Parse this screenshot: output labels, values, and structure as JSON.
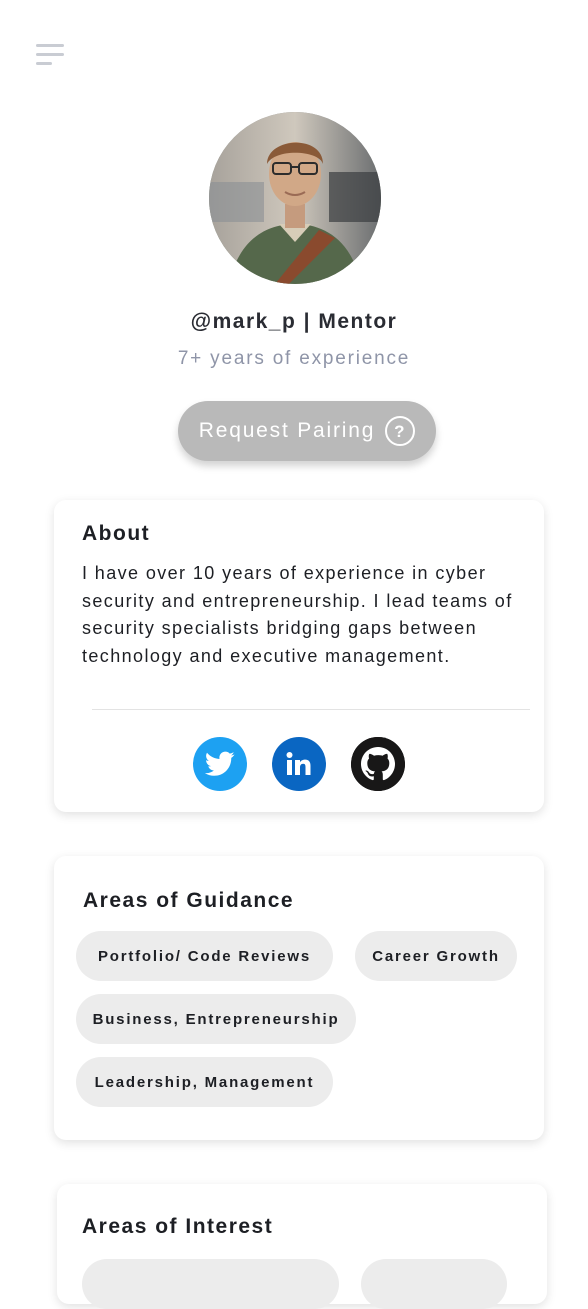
{
  "header": {
    "menu_icon": "hamburger-menu-icon"
  },
  "profile": {
    "avatar_alt": "profile photo",
    "handle": "@mark_p | Mentor",
    "experience": "7+ years of experience",
    "request_button": "Request Pairing",
    "help_glyph": "?"
  },
  "about": {
    "title": "About",
    "text": "I have over 10 years of experience in cyber security and entrepreneurship. I lead teams of security specialists bridging gaps between technology and executive management.",
    "socials": [
      {
        "name": "twitter",
        "icon": "twitter-icon",
        "color": "#1da1f2"
      },
      {
        "name": "linkedin",
        "icon": "linkedin-icon",
        "color": "#0a66c2"
      },
      {
        "name": "github",
        "icon": "github-icon",
        "color": "#181717"
      }
    ]
  },
  "guidance": {
    "title": "Areas of Guidance",
    "tags": [
      "Portfolio/ Code Reviews",
      "Career Growth",
      "Business, Entrepreneurship",
      "Leadership, Management"
    ]
  },
  "interest": {
    "title": "Areas of Interest"
  },
  "colors": {
    "button_bg": "#b9b9b9",
    "tag_bg": "#ececec",
    "muted_text": "#8f95a8"
  }
}
